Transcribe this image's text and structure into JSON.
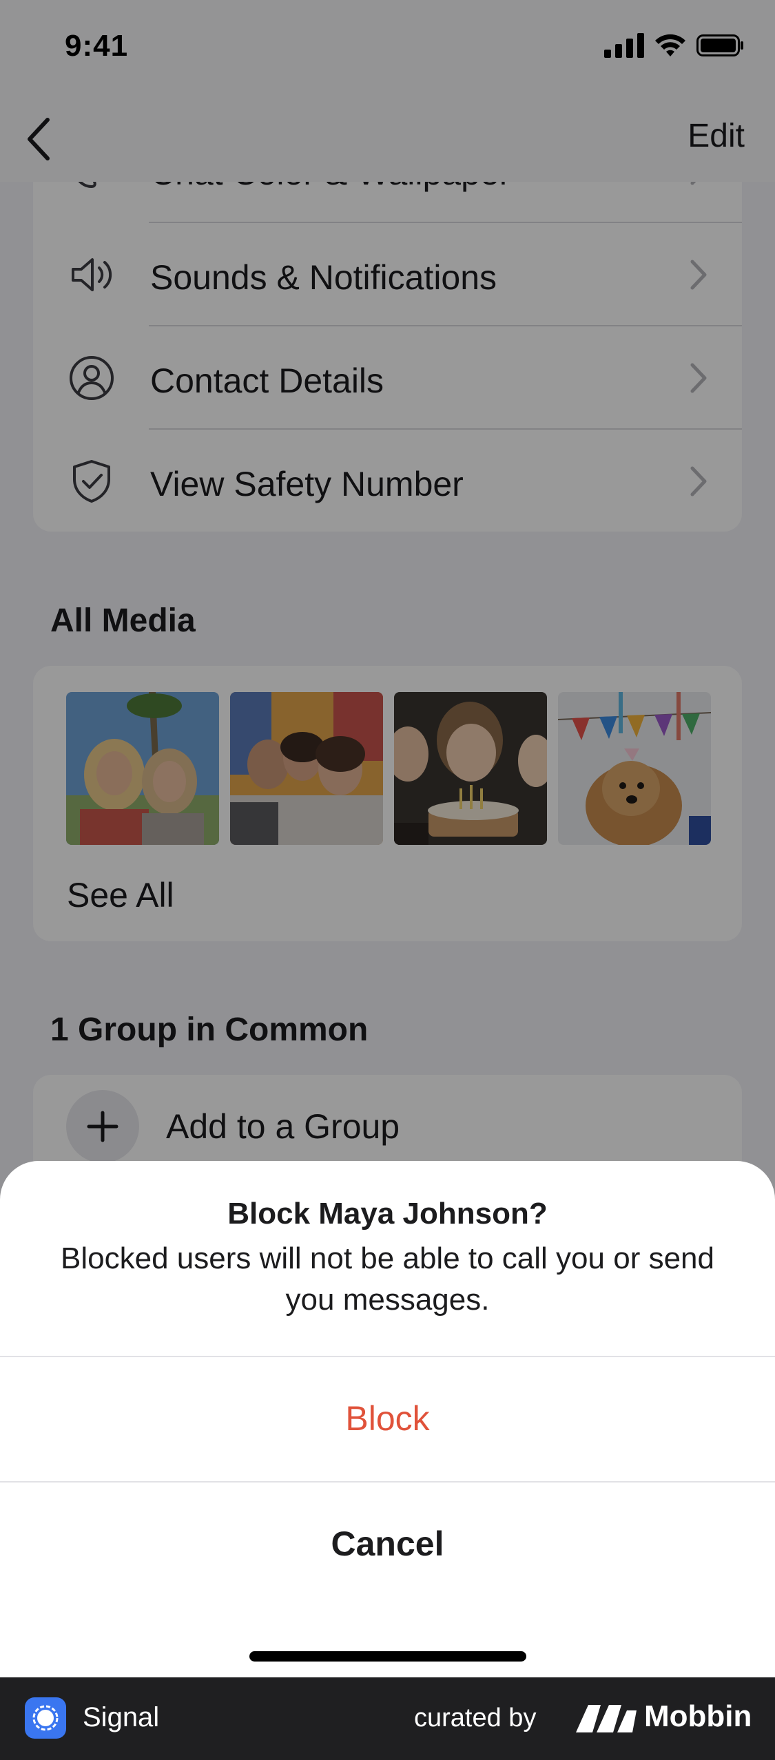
{
  "status_bar": {
    "time": "9:41"
  },
  "nav": {
    "edit_label": "Edit"
  },
  "settings": {
    "items": [
      {
        "label": "Chat Color & Wallpaper",
        "icon": "palette-icon"
      },
      {
        "label": "Sounds & Notifications",
        "icon": "speaker-icon"
      },
      {
        "label": "Contact Details",
        "icon": "person-circle-icon"
      },
      {
        "label": "View Safety Number",
        "icon": "shield-check-icon"
      }
    ]
  },
  "media": {
    "title": "All Media",
    "see_all_label": "See All",
    "thumbnails": [
      "friends-selfie-photo",
      "group-hug-photo",
      "birthday-cake-photo",
      "party-dog-photo"
    ]
  },
  "groups": {
    "title": "1 Group in Common",
    "add_label": "Add to a Group"
  },
  "sheet": {
    "title": "Block Maya Johnson?",
    "message": "Blocked users will not be able to call you or send you messages.",
    "block_label": "Block",
    "cancel_label": "Cancel"
  },
  "footer": {
    "app_name": "Signal",
    "curated_label": "curated by",
    "brand": "Mobbin"
  },
  "colors": {
    "destructive": "#e0523a",
    "signal_blue": "#3a76f0",
    "footer_bg": "#1f1f21"
  }
}
